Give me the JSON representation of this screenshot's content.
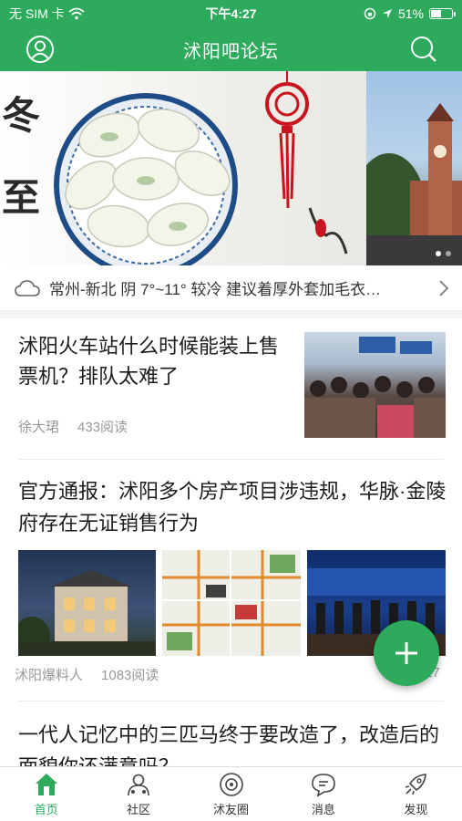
{
  "status_bar": {
    "carrier": "无 SIM 卡",
    "time": "下午4:27",
    "battery": "51%",
    "battery_level": 0.51
  },
  "header": {
    "title": "沭阳吧论坛",
    "profile_icon": "user-circle-icon",
    "search_icon": "search-icon"
  },
  "banner": {
    "slide_count": 2,
    "active_slide": 1,
    "slide_text": "冬至"
  },
  "weather": {
    "icon": "cloud-icon",
    "text": "常州-新北 阴 7°~11° 较冷 建议着厚外套加毛衣…"
  },
  "articles": [
    {
      "title": "沭阳火车站什么时候能装上售票机？排队太难了",
      "author": "徐大珺",
      "reads": "433阅读"
    },
    {
      "title": "官方通报：沭阳多个房产项目涉违规，华脉·金陵府存在无证销售行为",
      "author": "沭阳爆料人",
      "reads": "1083阅读",
      "extra": "27"
    },
    {
      "title": "一代人记忆中的三匹马终于要改造了，改造后的面貌你还满意吗？"
    }
  ],
  "fab": {
    "icon": "plus-icon"
  },
  "tabs": [
    {
      "label": "首页",
      "icon": "home-icon",
      "active": true
    },
    {
      "label": "社区",
      "icon": "community-icon",
      "active": false
    },
    {
      "label": "沭友圈",
      "icon": "friends-circle-icon",
      "active": false
    },
    {
      "label": "消息",
      "icon": "message-icon",
      "active": false
    },
    {
      "label": "发现",
      "icon": "discover-icon",
      "active": false
    }
  ],
  "colors": {
    "brand": "#2daa5b",
    "meta_text": "#999999",
    "title_text": "#1c1c1c"
  }
}
